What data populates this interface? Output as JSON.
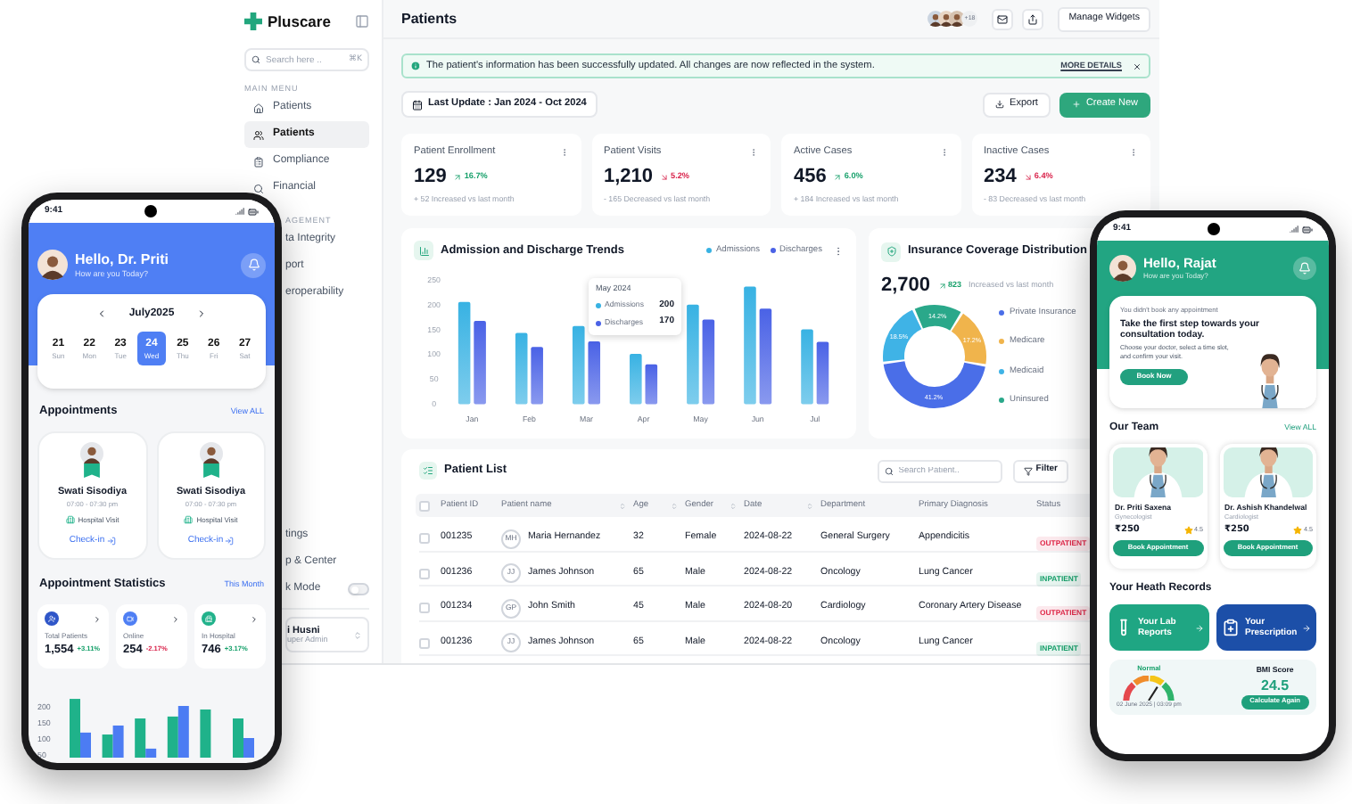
{
  "sidebar": {
    "brand": "Pluscare",
    "search": {
      "placeholder": "Search here ..",
      "shortcut": "⌘K"
    },
    "section": "MAIN MENU",
    "items": [
      {
        "label": "Patients",
        "selected": false
      },
      {
        "label": "Patients",
        "selected": true
      },
      {
        "label": "Compliance",
        "selected": false
      },
      {
        "label": "Financial",
        "selected": false
      }
    ],
    "section_2": "AGEMENT",
    "items_2": [
      {
        "label": "ta Integrity"
      },
      {
        "label": "port"
      },
      {
        "label": "eroperability"
      }
    ],
    "bottom_items": [
      {
        "label": "tings"
      },
      {
        "label": "p & Center"
      }
    ],
    "dark_mode": {
      "label": "k Mode",
      "on": false
    },
    "user": {
      "name": "i Husni",
      "role": "uper Admin"
    }
  },
  "header": {
    "title": "Patients",
    "more_count": "+18",
    "button": "Manage Widgets"
  },
  "alert": {
    "text": "The patient's information has been successfully updated. All changes are now reflected in the system.",
    "link": "MORE DETAILS"
  },
  "toolbar": {
    "range": "Last Update : Jan 2024 - Oct 2024",
    "export": "Export",
    "create": "Create New"
  },
  "stats": [
    {
      "title": "Patient Enrollment",
      "value": "129",
      "change": "16.7%",
      "up": true,
      "note": "+ 52 Increased vs last month"
    },
    {
      "title": "Patient Visits",
      "value": "1,210",
      "change": "5.2%",
      "up": false,
      "note": "- 165 Decreased vs last month"
    },
    {
      "title": "Active Cases",
      "value": "456",
      "change": "6.0%",
      "up": true,
      "note": "+ 184 Increased vs last month"
    },
    {
      "title": "Inactive Cases",
      "value": "234",
      "change": "6.4%",
      "up": false,
      "note": "- 83 Decreased vs last month"
    }
  ],
  "admissions": {
    "title": "Admission and Discharge Trends",
    "chart_data": {
      "type": "bar",
      "categories": [
        "Jan",
        "Feb",
        "Mar",
        "Apr",
        "May",
        "Jun",
        "Jul"
      ],
      "ylim": [
        0,
        250
      ],
      "yticks": [
        0,
        50,
        100,
        150,
        200,
        250
      ],
      "series": [
        {
          "name": "Admissions",
          "color": "#38b2e3",
          "values": [
            205,
            143,
            157,
            101,
            200,
            236,
            150
          ]
        },
        {
          "name": "Discharges",
          "color": "#4a62e6",
          "values": [
            167,
            115,
            126,
            80,
            170,
            192,
            125
          ]
        }
      ]
    },
    "tooltip": {
      "title": "May 2024",
      "rows": [
        {
          "label": "Admissions",
          "value": "200"
        },
        {
          "label": "Discharges",
          "value": "170"
        }
      ]
    }
  },
  "insurance": {
    "title": "Insurance Coverage Distribution",
    "total": "2,700",
    "change": "823",
    "note": "Increased vs last month",
    "chart_data": {
      "type": "donut",
      "categories": [
        "Private Insurance",
        "Medicare",
        "Medicaid",
        "Uninsured"
      ],
      "values": [
        41.2,
        17.2,
        18.5,
        14.2
      ],
      "value_labels": [
        "41.2%",
        "17.2%",
        "18.5%",
        "14.2%"
      ],
      "colors": [
        "#4a6ee8",
        "#f0b44c",
        "#3fb3e6",
        "#2aa88a"
      ]
    }
  },
  "patient_list": {
    "title": "Patient List",
    "search": {
      "placeholder": "Search Patient.."
    },
    "filter": "Filter",
    "all_selected": false,
    "columns": [
      {
        "label": "Patient ID",
        "sortable": false
      },
      {
        "label": "Patient name",
        "sortable": true
      },
      {
        "label": "Age",
        "sortable": true
      },
      {
        "label": "Gender",
        "sortable": true
      },
      {
        "label": "Date",
        "sortable": true
      },
      {
        "label": "Department",
        "sortable": false
      },
      {
        "label": "Primary Diagnosis",
        "sortable": false
      },
      {
        "label": "Status",
        "sortable": false
      }
    ],
    "rows": [
      {
        "selected": false,
        "id": "001235",
        "initials": "MH",
        "name": "Maria Hernandez",
        "age": "32",
        "gender": "Female",
        "date": "2024-08-22",
        "department": "General Surgery",
        "diagnosis": "Appendicitis",
        "status": {
          "text": "OUTPATIENT",
          "color": "#e0294a"
        }
      },
      {
        "selected": false,
        "id": "001236",
        "initials": "JJ",
        "name": "James Johnson",
        "age": "65",
        "gender": "Male",
        "date": "2024-08-22",
        "department": "Oncology",
        "diagnosis": "Lung Cancer",
        "status": {
          "text": "INPATIENT",
          "color": "#16a06a"
        }
      },
      {
        "selected": false,
        "id": "001234",
        "initials": "GP",
        "name": "John Smith",
        "age": "45",
        "gender": "Male",
        "date": "2024-08-20",
        "department": "Cardiology",
        "diagnosis": "Coronary Artery Disease",
        "status": {
          "text": "OUTPATIENT",
          "color": "#e0294a"
        }
      },
      {
        "selected": false,
        "id": "001236",
        "initials": "JJ",
        "name": "James Johnson",
        "age": "65",
        "gender": "Male",
        "date": "2024-08-22",
        "department": "Oncology",
        "diagnosis": "Lung Cancer",
        "status": {
          "text": "INPATIENT",
          "color": "#16a06a"
        }
      }
    ]
  },
  "doctor_app": {
    "time": "9:41",
    "greeting": "Hello, Dr. Priti",
    "subtitle": "How are you Today?",
    "month": "July2025",
    "days": [
      {
        "date": "21",
        "day": "Sun",
        "selected": false
      },
      {
        "date": "22",
        "day": "Mon",
        "selected": false
      },
      {
        "date": "23",
        "day": "Tue",
        "selected": false
      },
      {
        "date": "24",
        "day": "Wed",
        "selected": true
      },
      {
        "date": "25",
        "day": "Thu",
        "selected": false
      },
      {
        "date": "26",
        "day": "Fri",
        "selected": false
      },
      {
        "date": "27",
        "day": "Sat",
        "selected": false
      }
    ],
    "appointments": {
      "title": "Appointments",
      "link": "View ALL",
      "items": [
        {
          "name": "Swati Sisodiya",
          "time": "07:00 - 07:30 pm",
          "type": "Hospital Visit",
          "action": "Check-in"
        },
        {
          "name": "Swati Sisodiya",
          "time": "07:00 - 07:30 pm",
          "type": "Hospital Visit",
          "action": "Check-in"
        }
      ]
    },
    "statistics": {
      "title": "Appointment Statistics",
      "period": "This Month",
      "items": [
        {
          "label": "Total Patients",
          "value": "1,554",
          "change": "+3.11%",
          "up": true
        },
        {
          "label": "Online",
          "value": "254",
          "change": "-2.17%",
          "up": false
        },
        {
          "label": "In Hospital",
          "value": "746",
          "change": "+3.17%",
          "up": true
        }
      ],
      "axis_labels": [
        "200",
        "150",
        "100",
        "50"
      ]
    }
  },
  "patient_app": {
    "time": "9:41",
    "greeting": "Hello, Rajat",
    "subtitle": "How are you Today?",
    "promo": {
      "note": "You didn't book any appointment",
      "headline": "Take the first step towards your consultation today.",
      "body": "Choose your doctor, select a time slot, and confirm your visit.",
      "button": "Book Now"
    },
    "team": {
      "title": "Our Team",
      "link": "View ALL",
      "doctors": [
        {
          "name": "Dr. Priti Saxena",
          "specialty": "Gynecologist",
          "price": "₹250",
          "rating": "4.5",
          "button": "Book Appointment"
        },
        {
          "name": "Dr. Ashish Khandelwal",
          "specialty": "Cardiologist",
          "price": "₹250",
          "rating": "4.5",
          "button": "Book Appointment"
        }
      ]
    },
    "records": {
      "title": "Your Heath Records",
      "tiles": [
        {
          "label": "Your Lab Reports",
          "color": "#1fa683"
        },
        {
          "label": "Your Prescription",
          "color": "#1c4fa8"
        }
      ],
      "bmi": {
        "status": "Normal",
        "date": "02 June 2025 | 03:09 pm",
        "label": "BMI Score",
        "value": "24.5",
        "button": "Calculate Again"
      }
    }
  }
}
